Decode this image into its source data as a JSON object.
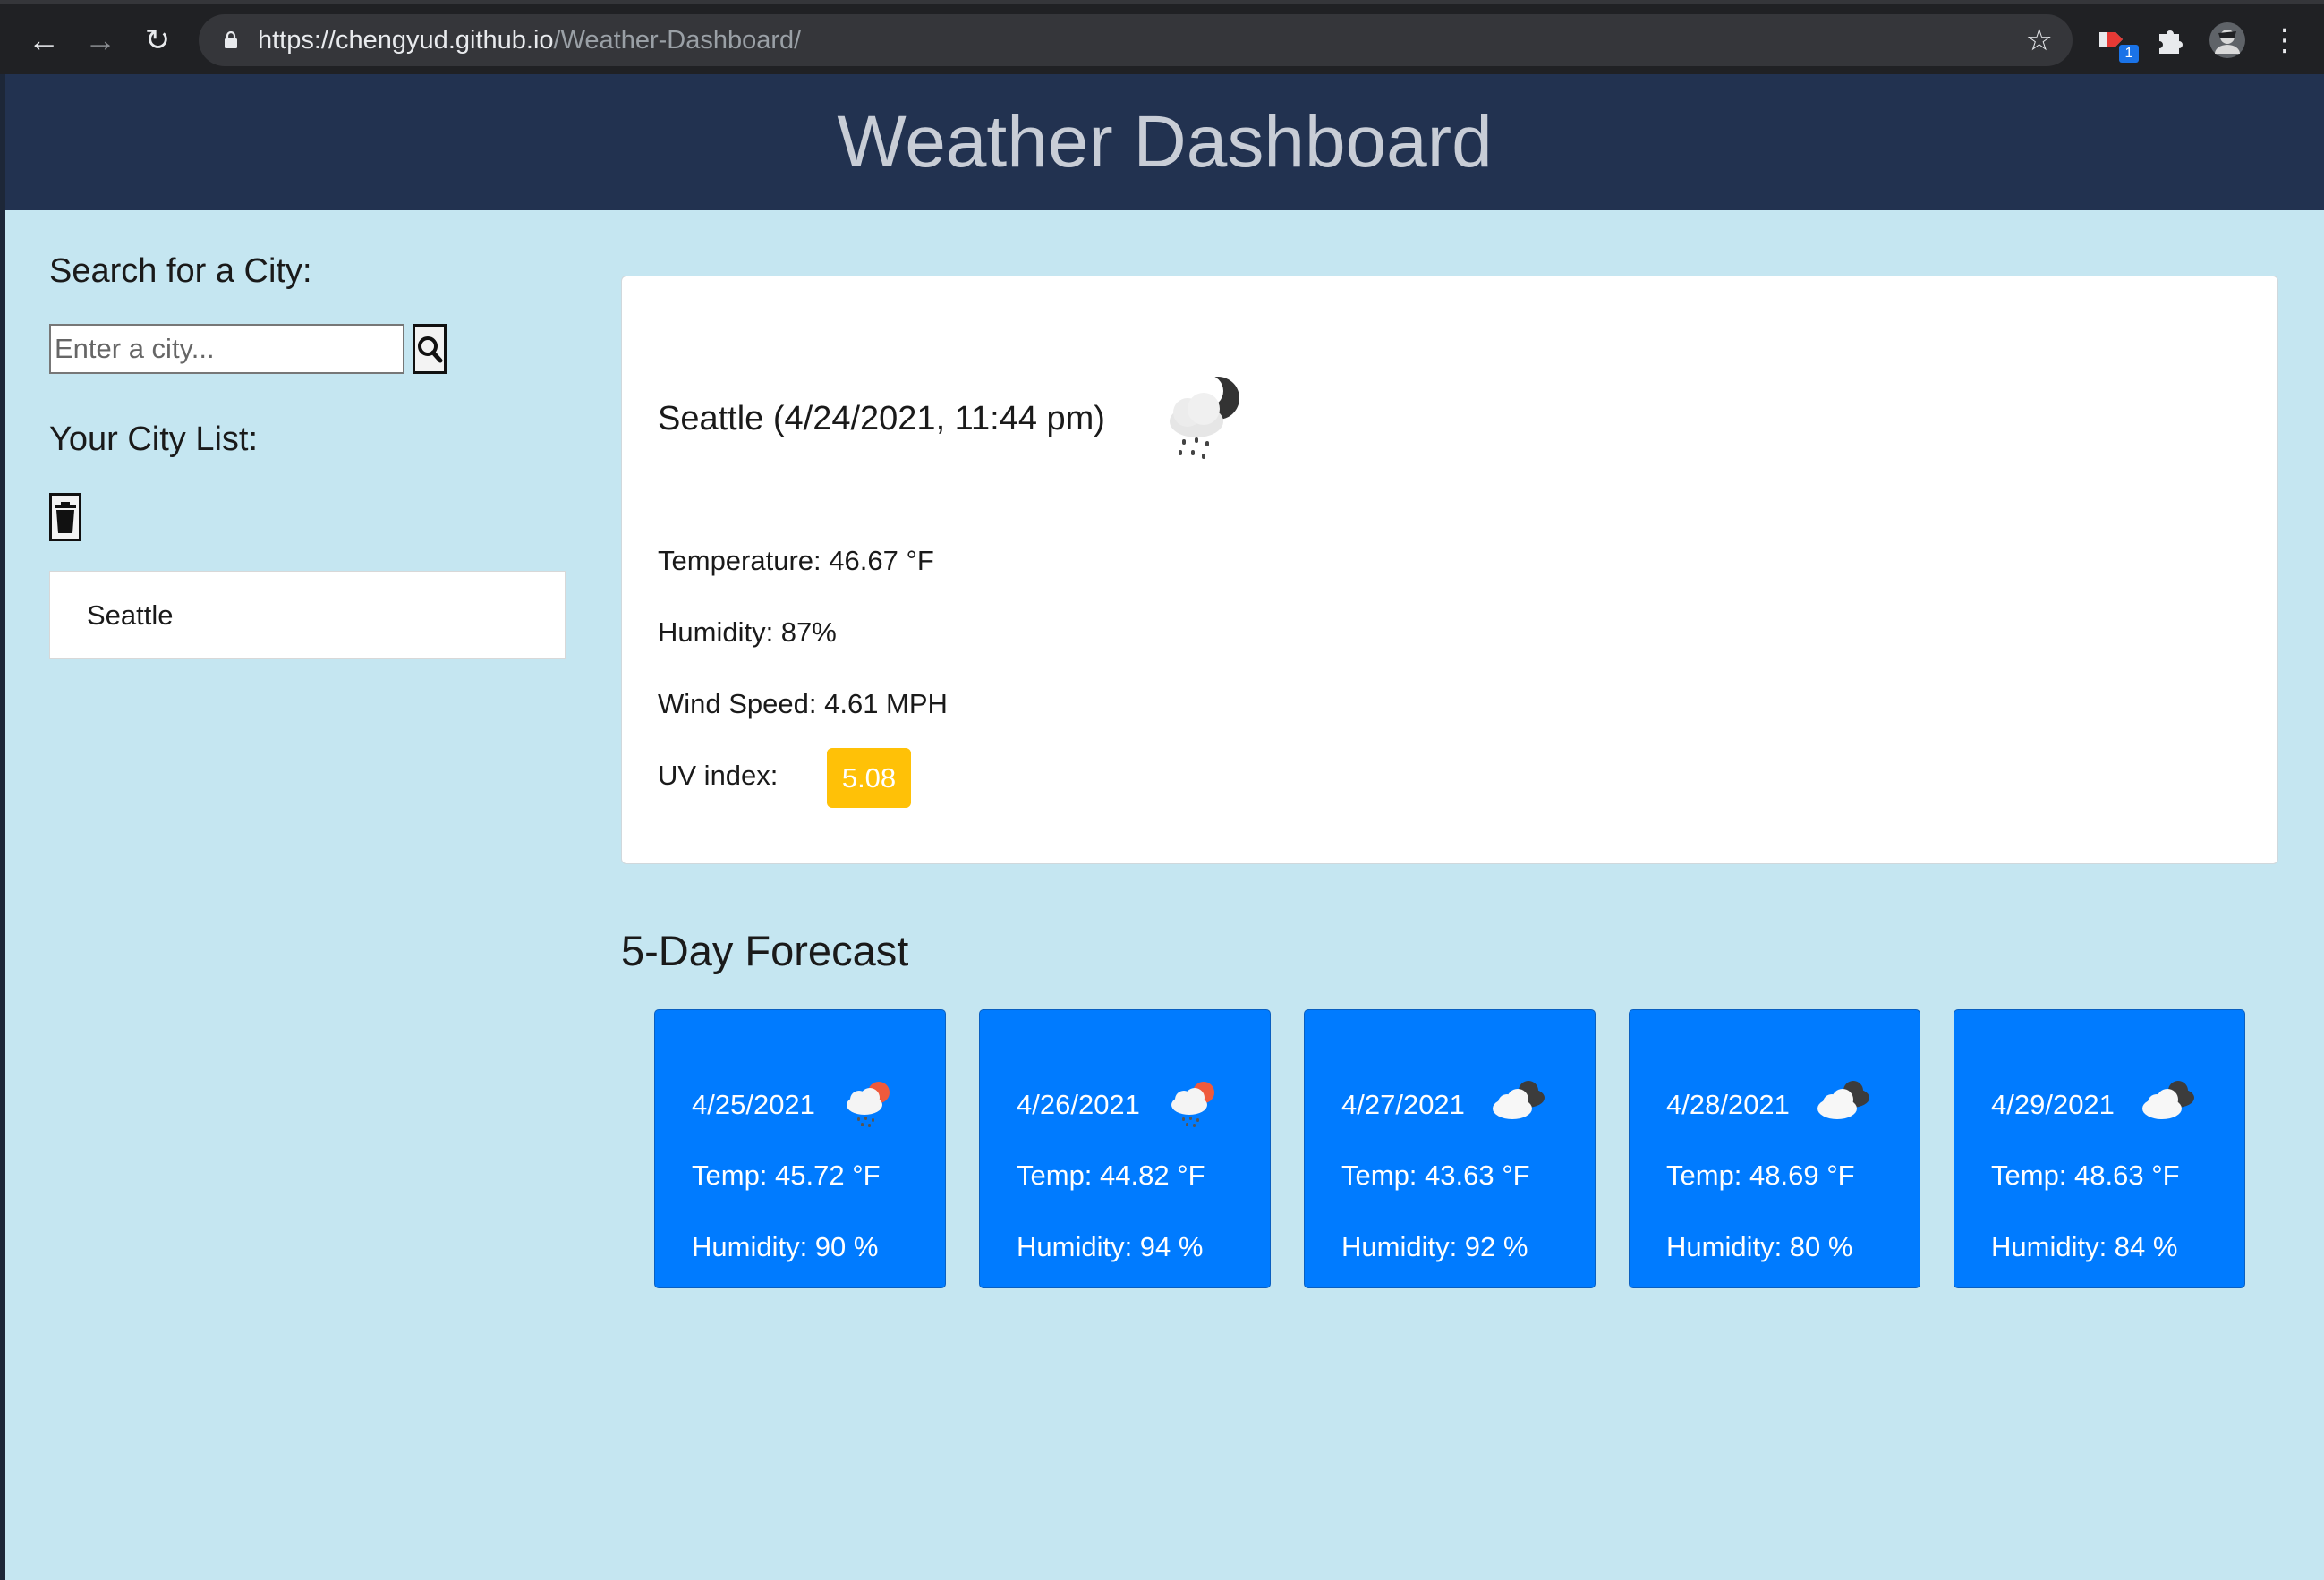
{
  "browser": {
    "url_host": "https://chengyud.github.io",
    "url_path": "/Weather-Dashboard/",
    "extension_badge": "1"
  },
  "header": {
    "title": "Weather Dashboard"
  },
  "sidebar": {
    "search_label": "Search for a City:",
    "search_placeholder": "Enter a city...",
    "city_list_label": "Your City List:",
    "cities": [
      "Seattle"
    ]
  },
  "current": {
    "title": "Seattle (4/24/2021, 11:44 pm)",
    "icon": "night-cloud-rain-icon",
    "temperature": "Temperature: 46.67 °F",
    "humidity": "Humidity: 87%",
    "wind": "Wind Speed: 4.61 MPH",
    "uv_label": "UV index:",
    "uv_value": "5.08",
    "uv_color": "#ffc107"
  },
  "forecast": {
    "title": "5-Day Forecast",
    "card_color": "#007bff",
    "days": [
      {
        "date": "4/25/2021",
        "icon": "day-cloud-rain-icon",
        "temp": "Temp: 45.72 °F",
        "humidity": "Humidity: 90 %"
      },
      {
        "date": "4/26/2021",
        "icon": "day-cloud-rain-icon",
        "temp": "Temp: 44.82 °F",
        "humidity": "Humidity: 94 %"
      },
      {
        "date": "4/27/2021",
        "icon": "broken-clouds-icon",
        "temp": "Temp: 43.63 °F",
        "humidity": "Humidity: 92 %"
      },
      {
        "date": "4/28/2021",
        "icon": "broken-clouds-icon",
        "temp": "Temp: 48.69 °F",
        "humidity": "Humidity: 80 %"
      },
      {
        "date": "4/29/2021",
        "icon": "broken-clouds-icon",
        "temp": "Temp: 48.63 °F",
        "humidity": "Humidity: 84 %"
      }
    ]
  }
}
